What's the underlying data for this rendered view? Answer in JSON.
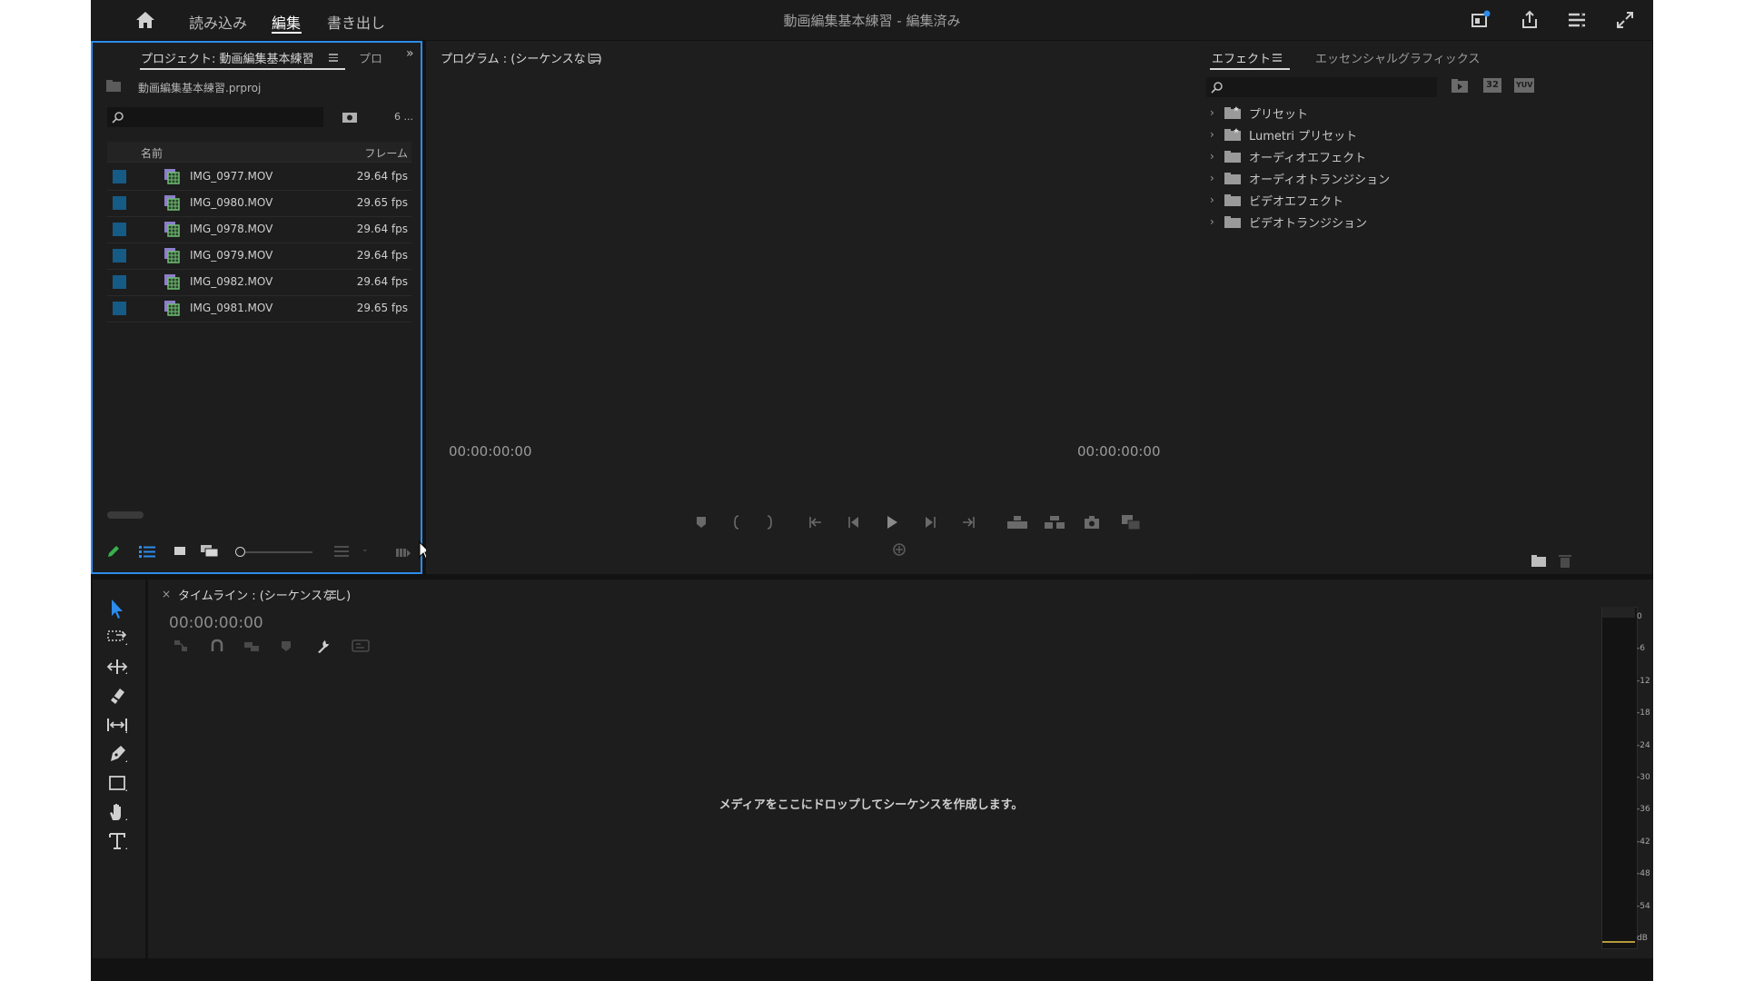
{
  "header": {
    "nav": [
      "読み込み",
      "編集",
      "書き出し"
    ],
    "active_nav": "編集",
    "title": "動画編集基本練習 - 編集済み"
  },
  "project_panel": {
    "tabs": [
      "プロジェクト: 動画編集基本練習",
      "プロ"
    ],
    "file": "動画編集基本練習.prproj",
    "item_count": "6 ...",
    "columns": [
      "名前",
      "フレーム"
    ],
    "rows": [
      {
        "name": "IMG_0977.MOV",
        "fps": "29.64 fps"
      },
      {
        "name": "IMG_0980.MOV",
        "fps": "29.65 fps"
      },
      {
        "name": "IMG_0978.MOV",
        "fps": "29.64 fps"
      },
      {
        "name": "IMG_0979.MOV",
        "fps": "29.64 fps"
      },
      {
        "name": "IMG_0982.MOV",
        "fps": "29.64 fps"
      },
      {
        "name": "IMG_0981.MOV",
        "fps": "29.65 fps"
      }
    ]
  },
  "program_monitor": {
    "title": "プログラム : (シーケンスなし)",
    "timecode_in": "00:00:00:00",
    "timecode_out": "00:00:00:00"
  },
  "effects_panel": {
    "tabs": [
      "エフェクト",
      "エッセンシャルグラフィックス"
    ],
    "items": [
      "プリセット",
      "Lumetri プリセット",
      "オーディオエフェクト",
      "オーディオトランジション",
      "ビデオエフェクト",
      "ビデオトランジション"
    ],
    "badges": [
      "32",
      "YUV"
    ]
  },
  "timeline": {
    "title": "タイムライン : (シーケンスなし)",
    "timecode": "00:00:00:00",
    "empty_message": "メディアをここにドロップしてシーケンスを作成します。"
  },
  "audio_meter": {
    "labels": [
      "0",
      "-6",
      "-12",
      "-18",
      "-24",
      "-30",
      "-36",
      "-42",
      "-48",
      "-54",
      "dB"
    ]
  },
  "colors": {
    "accent_blue": "#2d8ceb",
    "label_swatch": "#165a86",
    "panel_bg": "#1d1d1d",
    "app_bg": "#121212"
  }
}
